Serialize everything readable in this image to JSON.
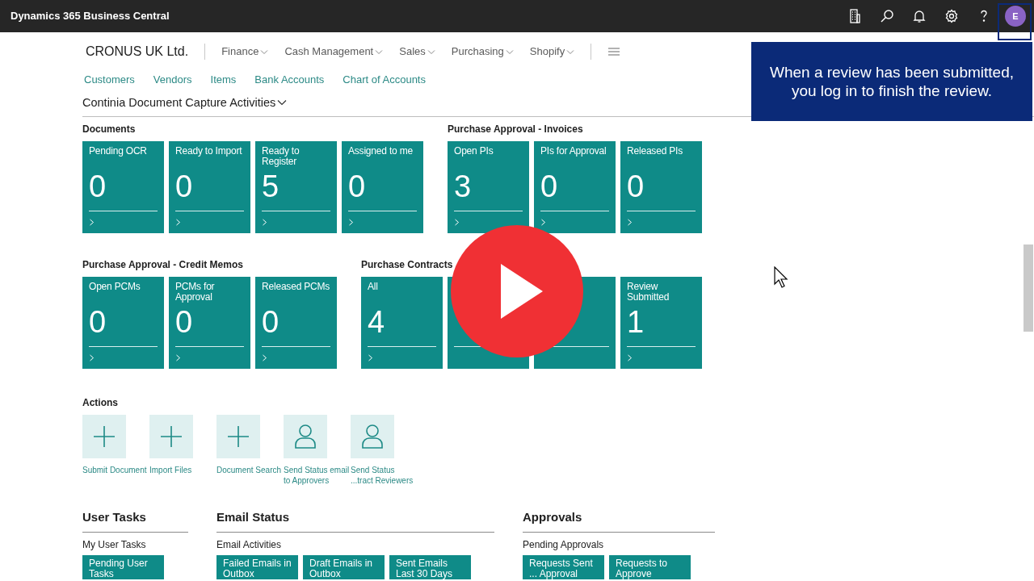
{
  "top_bar": {
    "title": "Dynamics 365 Business Central",
    "avatar": "E"
  },
  "company": "CRONUS UK Ltd.",
  "menus": [
    {
      "label": "Finance"
    },
    {
      "label": "Cash Management"
    },
    {
      "label": "Sales"
    },
    {
      "label": "Purchasing"
    },
    {
      "label": "Shopify"
    }
  ],
  "quick_links": [
    "Customers",
    "Vendors",
    "Items",
    "Bank Accounts",
    "Chart of Accounts"
  ],
  "activities_title": "Continia Document Capture Activities",
  "tile_rows": [
    [
      {
        "title": "Documents",
        "tiles": [
          {
            "label": "Pending OCR",
            "value": "0"
          },
          {
            "label": "Ready to Import",
            "value": "0"
          },
          {
            "label": "Ready to Register",
            "value": "5"
          },
          {
            "label": "Assigned to me",
            "value": "0"
          }
        ]
      },
      {
        "title": "Purchase Approval - Invoices",
        "tiles": [
          {
            "label": "Open PIs",
            "value": "3"
          },
          {
            "label": "PIs for Approval",
            "value": "0"
          },
          {
            "label": "Released PIs",
            "value": "0"
          }
        ]
      }
    ],
    [
      {
        "title": "Purchase Approval - Credit Memos",
        "tiles": [
          {
            "label": "Open PCMs",
            "value": "0"
          },
          {
            "label": "PCMs for Approval",
            "value": "0"
          },
          {
            "label": "Released PCMs",
            "value": "0"
          }
        ]
      },
      {
        "title": "Purchase Contracts",
        "tiles": [
          {
            "label": "All",
            "value": "4"
          },
          {
            "kind": "covered"
          },
          {
            "kind": "covered"
          },
          {
            "label": "Review Submitted",
            "value": "1"
          }
        ]
      }
    ]
  ],
  "actions_title": "Actions",
  "actions": [
    {
      "kind": "add",
      "label": "Submit Document"
    },
    {
      "kind": "add",
      "label": "Import Files"
    },
    {
      "kind": "add",
      "label": "Document Search"
    },
    {
      "kind": "person",
      "label": "Send Status email to Approvers"
    },
    {
      "kind": "person",
      "label": "Send Status ...tract Reviewers"
    }
  ],
  "sections": [
    {
      "title": "User Tasks",
      "subtitle": "My User Tasks",
      "tiles": [
        "Pending User Tasks"
      ]
    },
    {
      "title": "Email Status",
      "subtitle": "Email Activities",
      "tiles": [
        "Failed Emails in Outbox",
        "Draft Emails in Outbox",
        "Sent Emails Last 30 Days"
      ]
    },
    {
      "title": "Approvals",
      "subtitle": "Pending Approvals",
      "tiles": [
        "Requests Sent ... Approval",
        "Requests to Approve"
      ]
    }
  ],
  "callout": {
    "text": "When a review has been submitted, you log in to finish the review."
  }
}
